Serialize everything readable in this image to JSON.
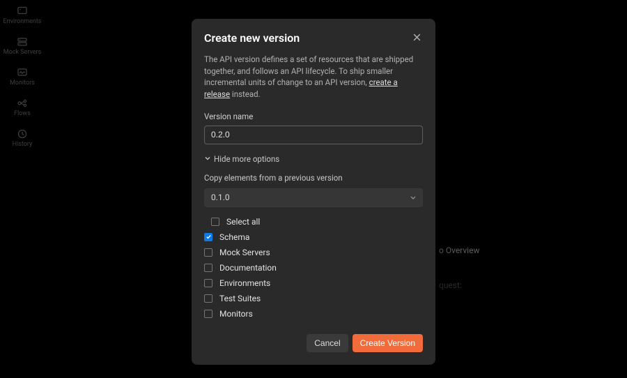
{
  "rail": {
    "items": [
      {
        "icon": "environments-icon",
        "label": "Environments"
      },
      {
        "icon": "mock-servers-icon",
        "label": "Mock Servers"
      },
      {
        "icon": "monitors-icon",
        "label": "Monitors"
      },
      {
        "icon": "flows-icon",
        "label": "Flows"
      },
      {
        "icon": "history-icon",
        "label": "History"
      }
    ]
  },
  "background": {
    "overview_suffix": "o Overview",
    "request_suffix": "quest:"
  },
  "modal": {
    "title": "Create new version",
    "desc_prefix": "The API version defines a set of resources that are shipped together, and follows an API lifecycle. To ship smaller incremental units of change to an API version, ",
    "link_text": "create a release",
    "desc_suffix": " instead.",
    "version_name_label": "Version name",
    "version_name_value": "0.2.0",
    "toggle_label": "Hide more options",
    "copy_label": "Copy elements from a previous version",
    "copy_selected": "0.1.0",
    "select_all_label": "Select all",
    "select_all_checked": false,
    "items": [
      {
        "label": "Schema",
        "checked": true
      },
      {
        "label": "Mock Servers",
        "checked": false
      },
      {
        "label": "Documentation",
        "checked": false
      },
      {
        "label": "Environments",
        "checked": false
      },
      {
        "label": "Test Suites",
        "checked": false
      },
      {
        "label": "Monitors",
        "checked": false
      }
    ],
    "cancel_label": "Cancel",
    "create_label": "Create Version"
  }
}
